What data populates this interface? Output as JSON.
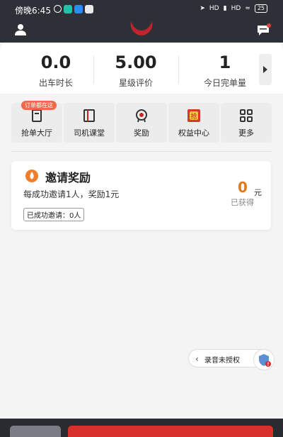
{
  "status_bar": {
    "time": "傍晚6:45",
    "network_a": "HD",
    "network_b": "HD",
    "battery": "25"
  },
  "header": {
    "left_icon": "user-icon",
    "logo": "horns-logo",
    "right_icon": "message-icon"
  },
  "stats": [
    {
      "value": "0.0",
      "label": "出车时长"
    },
    {
      "value": "5.00",
      "label": "星级评价"
    },
    {
      "value": "1",
      "label": "今日完单量"
    }
  ],
  "menu": {
    "badge": "订单都在这",
    "items": [
      {
        "label": "抢单大厅",
        "icon": "order-hall-icon"
      },
      {
        "label": "司机课堂",
        "icon": "book-icon"
      },
      {
        "label": "奖励",
        "icon": "medal-icon"
      },
      {
        "label": "权益中心",
        "icon": "rights-icon"
      },
      {
        "label": "更多",
        "icon": "grid-icon"
      }
    ]
  },
  "invite": {
    "title": "邀请奖励",
    "description": "每成功邀请1人，奖励1元",
    "invited_count": "已成功邀请：0人",
    "amount": "0",
    "unit": "元",
    "earned_label": "已获得"
  },
  "floating": {
    "record_label": "录音未授权"
  },
  "colors": {
    "header_bg": "#2e3038",
    "accent_red": "#d8302c",
    "amount_orange": "#e07a20",
    "badge_orange": "#f06a4a"
  }
}
